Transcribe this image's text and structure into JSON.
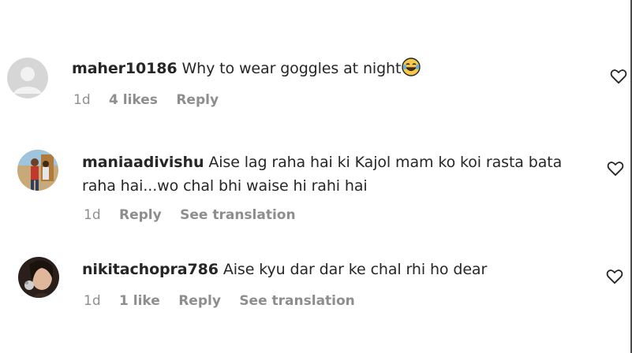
{
  "comments": [
    {
      "username": "maher10186",
      "text": "Why to wear goggles at night",
      "emoji": "laughing-with-tears-emoji",
      "time": "1d",
      "likes": "4 likes",
      "reply": "Reply"
    },
    {
      "username": "maniaadivishu",
      "text_line1": "Aise lag raha hai ki Kajol mam ko koi rasta bata",
      "text_line2": "raha hai...wo chal bhi waise hi rahi hai",
      "time": "1d",
      "reply": "Reply",
      "translation": "See translation"
    },
    {
      "username": "nikitachopra786",
      "text": "Aise kyu dar dar ke chal rhi ho dear",
      "time": "1d",
      "likes": "1 like",
      "reply": "Reply",
      "translation": "See translation"
    }
  ],
  "colors": {
    "text": "#262626",
    "meta": "#8e8e8e",
    "background": "#ffffff"
  }
}
